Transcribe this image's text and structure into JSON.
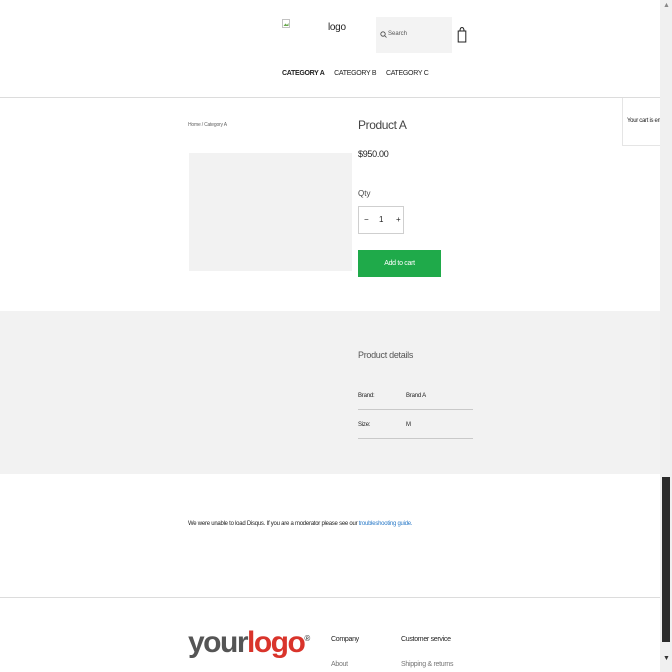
{
  "header": {
    "logo_text": "logo",
    "search_placeholder": "Search",
    "nav": [
      "CATEGORY A",
      "CATEGORY B",
      "CATEGORY C"
    ]
  },
  "cart": {
    "empty_text": "Your cart is empty"
  },
  "product": {
    "breadcrumb": "Home / Category A",
    "title": "Product A",
    "price": "$950.00",
    "qty_label": "Qty",
    "qty_value": "1",
    "minus": "−",
    "plus": "+",
    "add_to_cart": "Add to cart",
    "accent_color": "#1faa4a"
  },
  "details": {
    "title": "Product details",
    "rows": [
      {
        "label": "Brand:",
        "value": "Brand A"
      },
      {
        "label": "Size:",
        "value": "M"
      }
    ]
  },
  "disqus": {
    "message": "We were unable to load Disqus. If you are a moderator please see our",
    "link_text": "troubleshooting guide."
  },
  "footer": {
    "logo_main": "your",
    "logo_accent": "logo",
    "logo_mark": "®",
    "columns": [
      {
        "heading": "Company",
        "link": "About"
      },
      {
        "heading": "Customer service",
        "link": "Shipping & returns"
      }
    ]
  },
  "icons": {
    "search": "search-icon",
    "bag": "shopping-bag-icon",
    "broken_image": "broken-image-icon"
  }
}
